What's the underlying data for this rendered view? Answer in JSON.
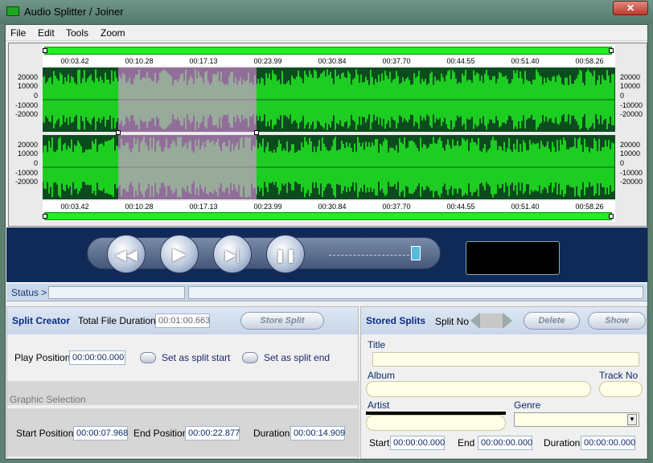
{
  "window": {
    "title": "Audio Splitter / Joiner",
    "close_glyph": "✕"
  },
  "menu": [
    "File",
    "Edit",
    "Tools",
    "Zoom"
  ],
  "timeline": {
    "ticks": [
      "00:03.42",
      "00:10.28",
      "00:17.13",
      "00:23.99",
      "00:30.84",
      "00:37.70",
      "00:44.55",
      "00:51.40",
      "00:58.26"
    ],
    "amplitude_labels": [
      "20000",
      "10000",
      "0",
      "-10000",
      "-20000"
    ],
    "selection_start": "00:07.968",
    "selection_end": "00:22.877",
    "colors": {
      "wave": "#22ee22",
      "wave_bg": "#0c4b1e",
      "selection": "#ff88ff"
    }
  },
  "player": {
    "buttons": [
      {
        "name": "rewind-button",
        "glyph": "◀◀"
      },
      {
        "name": "play-button",
        "glyph": "▶"
      },
      {
        "name": "play-selection-button",
        "glyph": "▶|"
      },
      {
        "name": "pause-button",
        "glyph": "❚❚"
      }
    ]
  },
  "status": {
    "label": "Status >"
  },
  "split_creator": {
    "title": "Split Creator",
    "total_duration_label": "Total File Duration",
    "total_duration": "00:01:00.663",
    "store_button": "Store Split",
    "play_position_label": "Play Position",
    "play_position": "00:00:00.000",
    "set_start_label": "Set as split start",
    "set_end_label": "Set as split end",
    "graphic_selection_label": "Graphic Selection",
    "start_position_label": "Start Position",
    "start_position": "00:00:07.968",
    "end_position_label": "End Position",
    "end_position": "00:00:22.877",
    "duration_label": "Duration",
    "duration": "00:00:14.909"
  },
  "stored_splits": {
    "title": "Stored Splits",
    "split_no_label": "Split No",
    "delete_button": "Delete",
    "show_button": "Show",
    "title_label": "Title",
    "album_label": "Album",
    "track_no_label": "Track No",
    "artist_label": "Artist",
    "genre_label": "Genre",
    "start_label": "Start",
    "start_value": "00:00:00.000",
    "end_label": "End",
    "end_value": "00:00:00.000",
    "duration_label": "Duration",
    "duration_value": "00:00:00.000"
  }
}
